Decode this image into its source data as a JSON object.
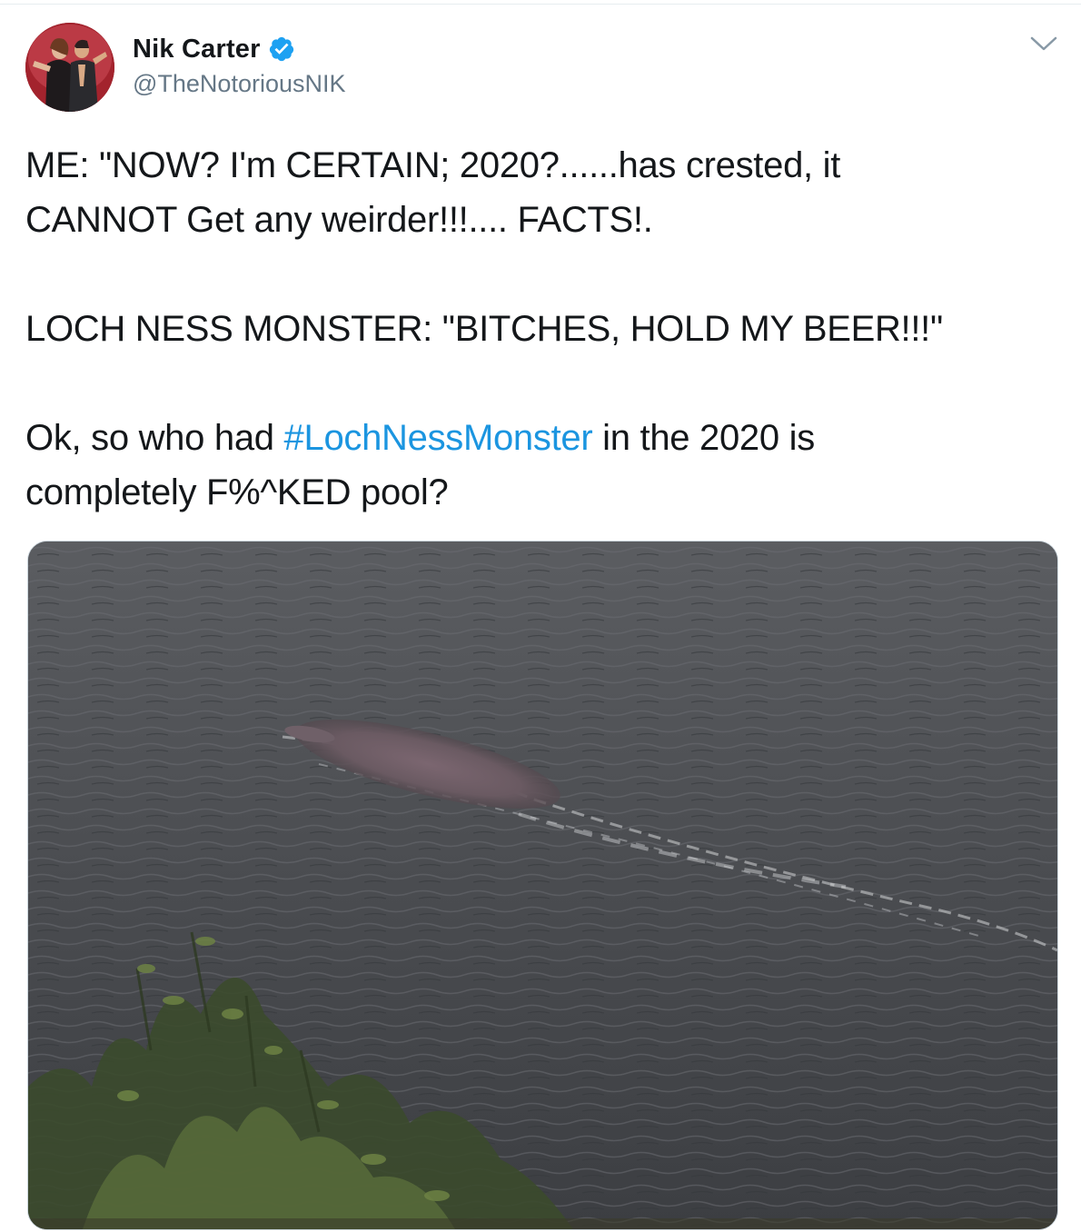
{
  "tweet": {
    "author": {
      "display_name": "Nik Carter",
      "handle": "@TheNotoriousNIK",
      "verified": true,
      "verified_badge_color": "#1da1f2"
    },
    "text": {
      "para1_line1": "ME: \"NOW? I'm CERTAIN; 2020?......has crested, it",
      "para1_line2": "CANNOT Get any weirder!!!.... FACTS!.",
      "para2": "LOCH NESS MONSTER: \"BITCHES, HOLD MY BEER!!!\"",
      "para3_before": "Ok, so who had ",
      "hashtag": "#LochNessMonster",
      "para3_after": " in the 2020 is",
      "para3_line2": "completely F%^KED pool?"
    },
    "hashtag_color": "#1b95e0",
    "media": {
      "icon": "photo-icon"
    },
    "menu_icon": "chevron-down-icon"
  }
}
